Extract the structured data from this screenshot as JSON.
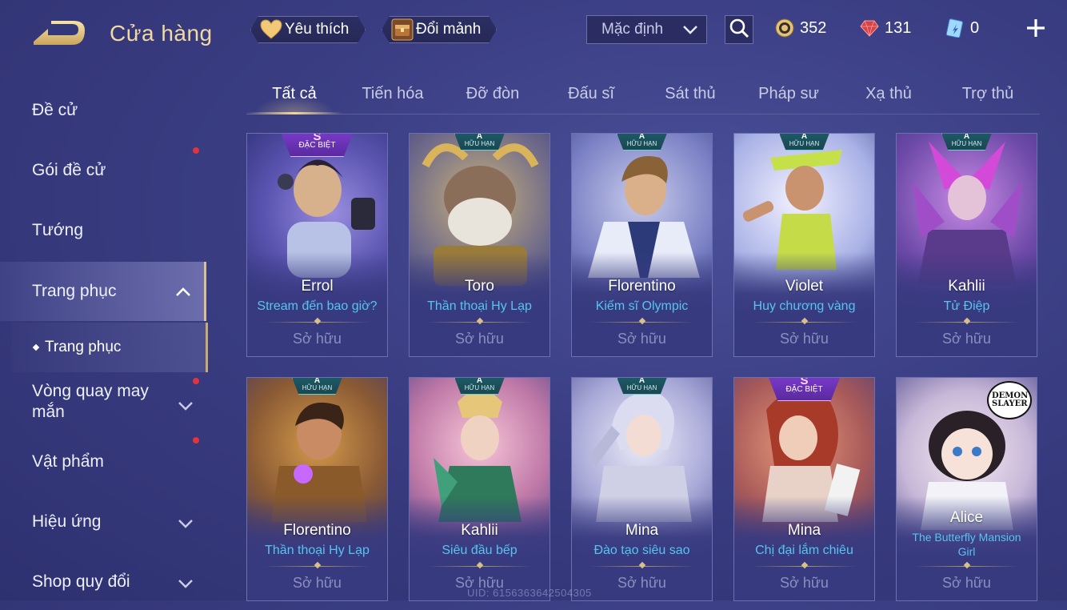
{
  "header": {
    "title": "Cửa hàng",
    "favorite_label": "Yêu thích",
    "shard_label": "Đổi mảnh",
    "sort_value": "Mặc định",
    "currencies": {
      "gold": "352",
      "ruby": "131",
      "voucher": "0"
    }
  },
  "sidebar": {
    "items": [
      {
        "label": "Đề cử"
      },
      {
        "label": "Gói đề cử"
      },
      {
        "label": "Tướng"
      },
      {
        "label": "Trang phục"
      },
      {
        "label": "Vòng quay may mắn"
      },
      {
        "label": "Vật phẩm"
      },
      {
        "label": "Hiệu ứng"
      },
      {
        "label": "Shop quy đổi"
      }
    ],
    "sub_item": "Trang phục"
  },
  "tabs": [
    {
      "label": "Tất cả"
    },
    {
      "label": "Tiến hóa"
    },
    {
      "label": "Đỡ đòn"
    },
    {
      "label": "Đấu sĩ"
    },
    {
      "label": "Sát thủ"
    },
    {
      "label": "Pháp sư"
    },
    {
      "label": "Xạ thủ"
    },
    {
      "label": "Trợ thủ"
    }
  ],
  "badges": {
    "a_grade": "A",
    "a_text": "HỮU HẠN",
    "s_grade": "S",
    "s_text": "ĐẶC BIỆT",
    "brand": "DEMON SLAYER"
  },
  "cards": [
    {
      "hero": "Errol",
      "skin": "Stream đến bao giờ?",
      "status": "Sở hữu",
      "badge": "S"
    },
    {
      "hero": "Toro",
      "skin": "Thần thoại Hy Lạp",
      "status": "Sở hữu",
      "badge": "A"
    },
    {
      "hero": "Florentino",
      "skin": "Kiếm sĩ Olympic",
      "status": "Sở hữu",
      "badge": "A"
    },
    {
      "hero": "Violet",
      "skin": "Huy chương vàng",
      "status": "Sở hữu",
      "badge": "A"
    },
    {
      "hero": "Kahlii",
      "skin": "Tử Điệp",
      "status": "Sở hữu",
      "badge": "A"
    },
    {
      "hero": "Florentino",
      "skin": "Thần thoại Hy Lạp",
      "status": "Sở hữu",
      "badge": "A"
    },
    {
      "hero": "Kahlii",
      "skin": "Siêu đầu bếp",
      "status": "Sở hữu",
      "badge": "A"
    },
    {
      "hero": "Mina",
      "skin": "Đào tạo siêu sao",
      "status": "Sở hữu",
      "badge": "A"
    },
    {
      "hero": "Mina",
      "skin": "Chị đại lắm chiêu",
      "status": "Sở hữu",
      "badge": "S"
    },
    {
      "hero": "Alice",
      "skin": "The Butterfly Mansion Girl",
      "status": "Sở hữu",
      "badge": "brand"
    }
  ],
  "footer": {
    "uid": "UID: 6156363642504305"
  },
  "colors": {
    "accent_gold": "#f1d9a2",
    "skin_name": "#56c4ee",
    "notify_dot": "#e2343a",
    "badge_s": "#7c3bcb",
    "badge_a": "#1d5b66"
  }
}
